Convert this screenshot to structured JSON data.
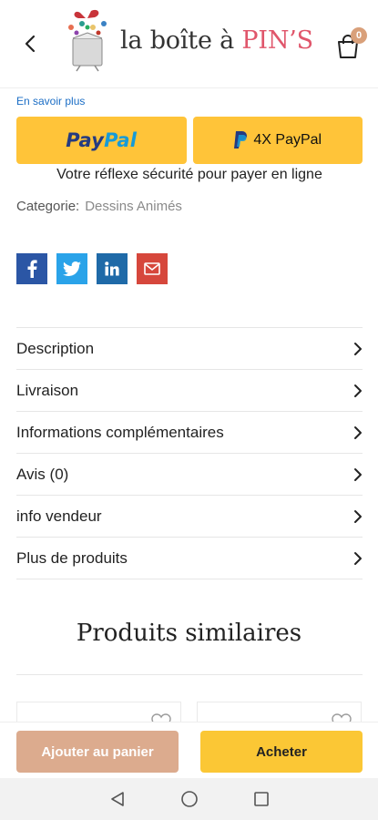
{
  "header": {
    "logo_text_main": "la boîte à ",
    "logo_text_accent": "PIN’S",
    "cart_count": "0"
  },
  "paypal": {
    "learn_more": "En savoir plus",
    "button_paypal_pay": "Pay",
    "button_paypal_pal": "Pal",
    "button_4x": "4X PayPal",
    "tagline": "Votre réflexe sécurité pour payer en ligne"
  },
  "category": {
    "label": "Categorie:",
    "value": "Dessins Animés"
  },
  "share": [
    "facebook-icon",
    "twitter-icon",
    "linkedin-icon",
    "email-icon"
  ],
  "accordion": [
    {
      "label": "Description"
    },
    {
      "label": "Livraison"
    },
    {
      "label": "Informations complémentaires"
    },
    {
      "label": "Avis (0)"
    },
    {
      "label": "info vendeur"
    },
    {
      "label": "Plus de produits"
    }
  ],
  "similar": {
    "title": "Produits similaires"
  },
  "actions": {
    "add_to_cart": "Ajouter au panier",
    "buy": "Acheter"
  },
  "colors": {
    "paypal_yellow": "#ffc439",
    "accent_pink": "#e0566b",
    "cart_button": "#dcab8e",
    "buy_button": "#fbc735"
  }
}
